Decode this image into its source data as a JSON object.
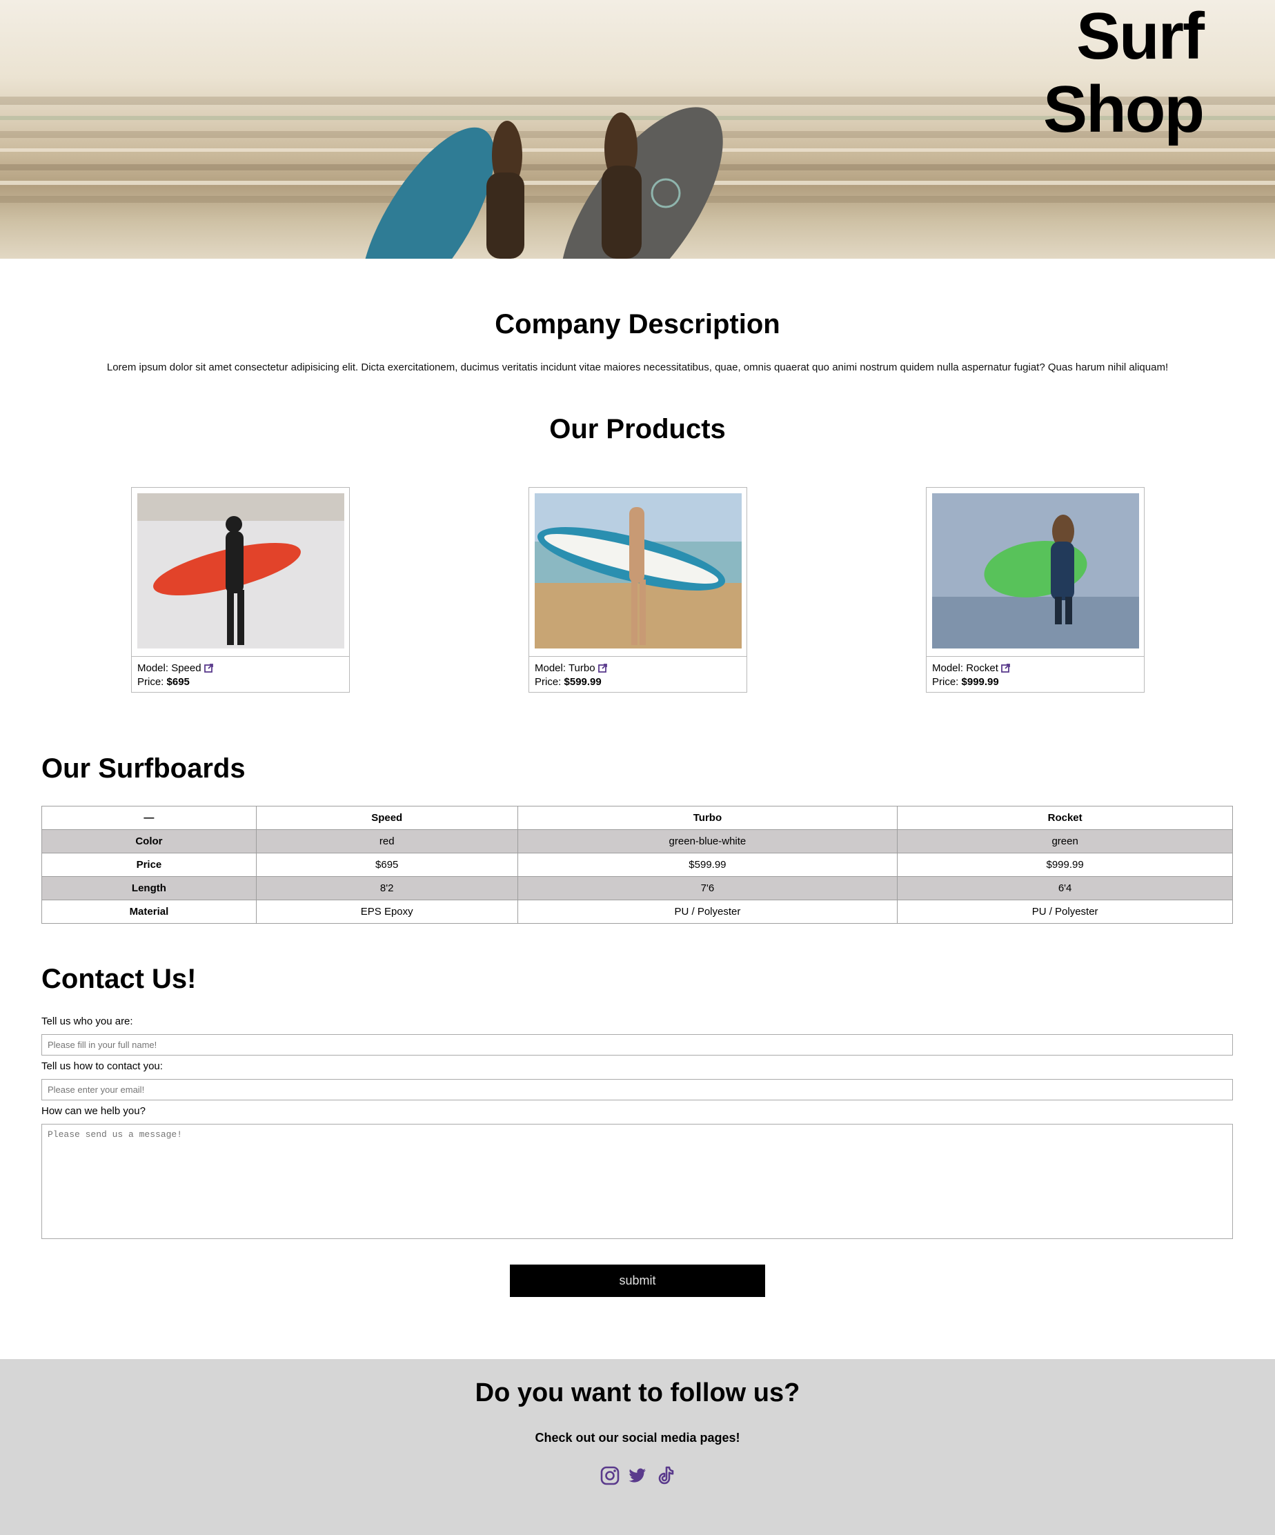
{
  "hero": {
    "title_line1": "Surf",
    "title_line2": "Shop"
  },
  "company": {
    "heading": "Company Description",
    "text": "Lorem ipsum dolor sit amet consectetur adipisicing elit. Dicta exercitationem, ducimus veritatis incidunt vitae maiores necessitatibus, quae, omnis quaerat quo animi nostrum quidem nulla aspernatur fugiat? Quas harum nihil aliquam!"
  },
  "products": {
    "heading": "Our Products",
    "model_prefix": "Model:",
    "price_prefix": "Price:",
    "items": [
      {
        "model": "Speed",
        "price": "$695",
        "board_color": "#e2432a"
      },
      {
        "model": "Turbo",
        "price": "$599.99",
        "board_color": "#2a8fb0"
      },
      {
        "model": "Rocket",
        "price": "$999.99",
        "board_color": "#58c25a"
      }
    ]
  },
  "surfboards": {
    "heading": "Our Surfboards",
    "header": [
      "—",
      "Speed",
      "Turbo",
      "Rocket"
    ],
    "rows": [
      {
        "label": "Color",
        "values": [
          "red",
          "green-blue-white",
          "green"
        ]
      },
      {
        "label": "Price",
        "values": [
          "$695",
          "$599.99",
          "$999.99"
        ]
      },
      {
        "label": "Length",
        "values": [
          "8'2",
          "7'6",
          "6'4"
        ]
      },
      {
        "label": "Material",
        "values": [
          "EPS Epoxy",
          "PU / Polyester",
          "PU / Polyester"
        ]
      }
    ]
  },
  "contact": {
    "heading": "Contact Us!",
    "name_label": "Tell us who you are:",
    "name_placeholder": "Please fill in your full name!",
    "email_label": "Tell us how to contact you:",
    "email_placeholder": "Please enter your email!",
    "message_label": "How can we helb you?",
    "message_placeholder": "Please send us a message!",
    "submit_label": "submit"
  },
  "footer": {
    "heading": "Do you want to follow us?",
    "subtext": "Check out our social media pages!",
    "icons": [
      "instagram-icon",
      "twitter-icon",
      "tiktok-icon"
    ],
    "icon_color": "#5a3a8c"
  },
  "colors": {
    "link_icon": "#5a3a8c",
    "table_shade": "#cdcacb",
    "footer_bg": "#d6d6d6",
    "button_bg": "#000000"
  }
}
